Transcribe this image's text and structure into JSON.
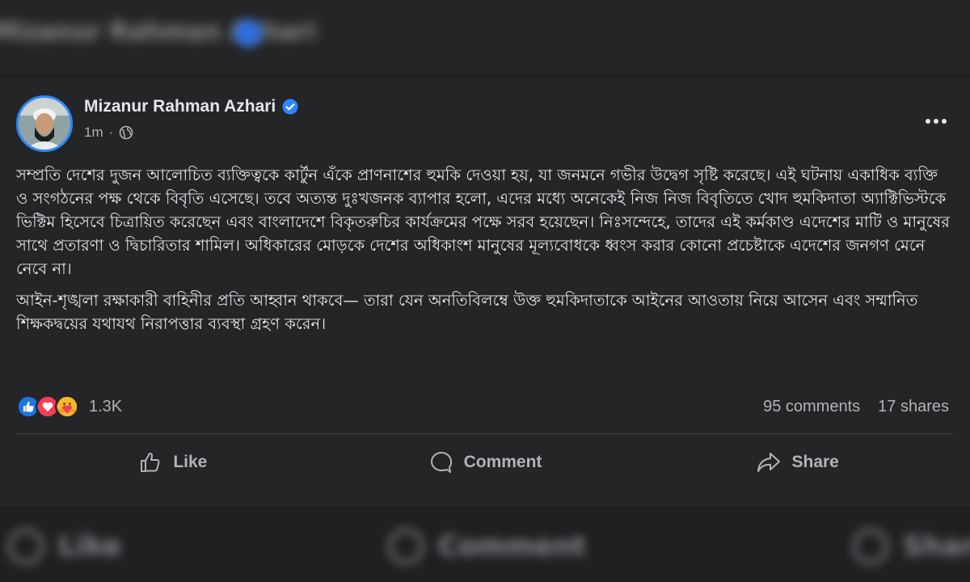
{
  "background": {
    "blurred_name": "Mizanur Rahman Azhari",
    "blurred_actions": [
      "Like",
      "Comment",
      "Share"
    ]
  },
  "post": {
    "author": "Mizanur Rahman Azhari",
    "time": "1m",
    "paragraphs": [
      "সম্প্রতি দেশের দুজন আলোচিত ব্যক্তিত্বকে কার্টুন এঁকে প্রাণনাশের হুমকি দেওয়া হয়, যা জনমনে গভীর উদ্বেগ সৃষ্টি করেছে। এই ঘটনায় একাধিক ব্যক্তি ও সংগঠনের পক্ষ থেকে বিবৃতি এসেছে। তবে অত্যন্ত দুঃখজনক ব্যাপার হলো, এদের মধ্যে অনেকেই নিজ নিজ বিবৃতিতে খোদ হুমকিদাতা অ্যাক্টিভিস্টকে ভিক্টিম হিসেবে চিত্রায়িত করেছেন এবং বাংলাদেশে বিকৃতরুচির কার্যক্রমের পক্ষে সরব হয়েছেন। নিঃসন্দেহে, তাদের এই কর্মকাণ্ড এদেশের মাটি ও মানুষের সাথে প্রতারণা ও দ্বিচারিতার শামিল। অধিকারের মোড়কে দেশের অধিকাংশ মানুষের মূল্যবোধকে ধ্বংস করার কোনো প্রচেষ্টাকে এদেশের জনগণ মেনে নেবে না।",
      "আইন-শৃঙ্খলা রক্ষাকারী বাহিনীর প্রতি আহ্বান থাকবে— তারা যেন অনতিবিলম্বে উক্ত হুমকিদাতাকে আইনের আওতায় নিয়ে আসেন এবং সম্মানিত শিক্ষকদ্বয়ের যথাযথ নিরাপত্তার ব্যবস্থা গ্রহণ করেন।"
    ],
    "reaction_count": "1.3K",
    "comments": "95 comments",
    "shares": "17 shares",
    "actions": {
      "like": "Like",
      "comment": "Comment",
      "share": "Share"
    }
  },
  "icons": {
    "verified": "verified-badge-icon",
    "privacy": "globe-icon",
    "more": "more-horizontal-icon",
    "reactions": [
      "like-reaction-icon",
      "love-reaction-icon",
      "care-reaction-icon"
    ]
  },
  "colors": {
    "card_bg": "#242526",
    "page_bg": "#1c1d1f",
    "text_primary": "#e4e6eb",
    "text_secondary": "#b0b3b8",
    "accent_blue": "#2d86ff",
    "love_red": "#f33e58",
    "care_yellow": "#f7b928"
  }
}
